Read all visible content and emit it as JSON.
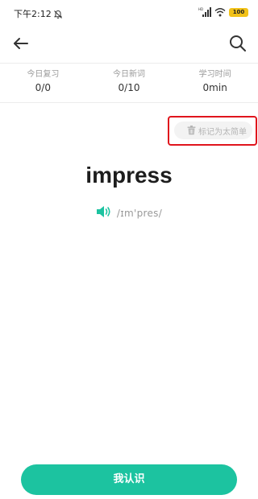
{
  "status_bar": {
    "time": "下午2:12",
    "network": "HD",
    "battery": "100"
  },
  "app_bar": {
    "back_icon": "arrow-left-icon",
    "search_icon": "search-icon"
  },
  "stats": [
    {
      "label": "今日复习",
      "value": "0/0"
    },
    {
      "label": "今日新词",
      "value": "0/10"
    },
    {
      "label": "学习时间",
      "value": "0min"
    }
  ],
  "mark_easy": {
    "icon": "trash-icon",
    "label": "标记为太简单"
  },
  "word": {
    "text": "impress",
    "phonetic": "/ɪm'pres/",
    "speaker_icon": "speaker-icon"
  },
  "know_button": {
    "label": "我认识"
  },
  "colors": {
    "accent": "#1cc3a0",
    "highlight": "#e0141c",
    "battery": "#f2c218"
  }
}
